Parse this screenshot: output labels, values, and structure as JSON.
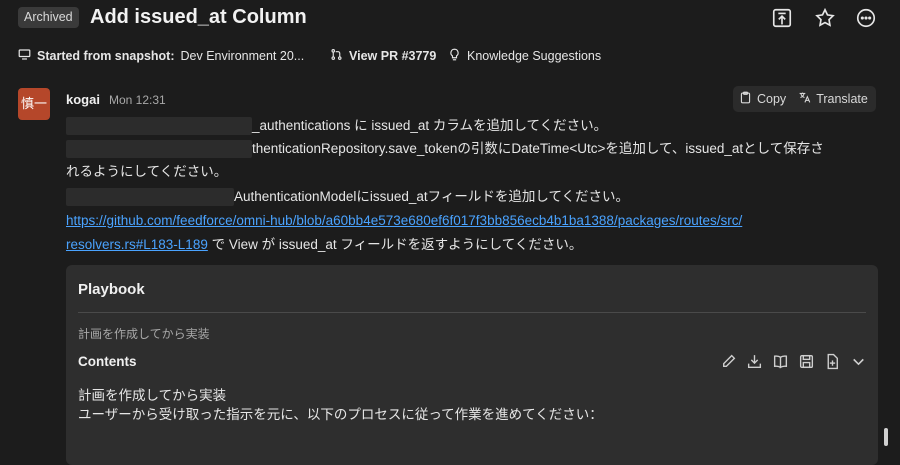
{
  "header": {
    "badge": "Archived",
    "title": "Add issued_at Column",
    "icons": [
      "share-icon",
      "star-icon",
      "more-icon"
    ]
  },
  "subbar": {
    "snapshot_label": "Started from snapshot:",
    "snapshot_value": "Dev Environment 20...",
    "pr_label": "View PR #3779",
    "knowledge_label": "Knowledge Suggestions"
  },
  "message": {
    "avatar": "慎一",
    "author": "kogai",
    "time": "Mon 12:31",
    "copy_label": "Copy",
    "translate_label": "Translate",
    "line1": "_authentications に issued_at カラムを追加してください。",
    "line2": "thenticationRepository.save_tokenの引数にDateTime<Utc>を追加して、issued_atとして保存さ",
    "line3": "れるようにしてください。",
    "line4": "AuthenticationModelにissued_atフィールドを追加してください。",
    "link_line1": "https://github.com/feedforce/omni-hub/blob/a60bb4e573e680ef6f017f3bb856ecb4b1ba1388/packages/routes/src/",
    "link_line2": "resolvers.rs#L183-L189",
    "link_suffix": " で View が issued_at フィールドを返すようにしてください。"
  },
  "playbook": {
    "title": "Playbook",
    "description": "計画を作成してから実装",
    "contents_label": "Contents",
    "tools": [
      "edit-icon",
      "download-icon",
      "book-icon",
      "save-icon",
      "add-file-icon",
      "chevron-down-icon"
    ],
    "body_line1": "計画を作成してから実装",
    "body_line2": "ユーザーから受け取った指示を元に、以下のプロセスに従って作業を進めてください："
  }
}
